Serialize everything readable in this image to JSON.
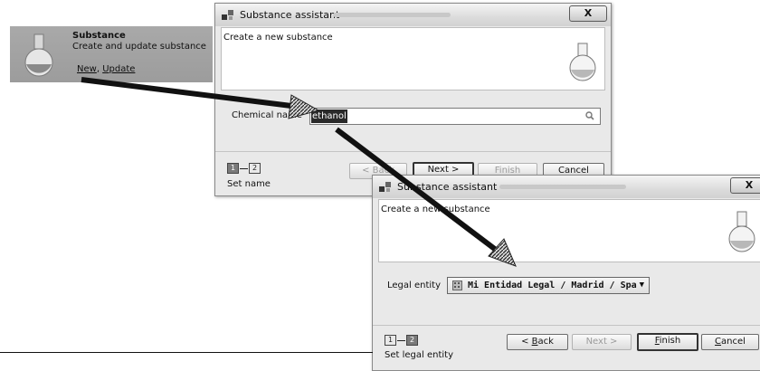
{
  "card": {
    "title": "Substance",
    "description": "Create and update substance",
    "link_new": "New",
    "link_separator": ",",
    "link_update": "Update",
    "icon": "flask-icon"
  },
  "dialog1": {
    "title": "Substance assistant",
    "close_label": "X",
    "header_text": "Create a new substance",
    "field_label": "Chemical name",
    "field_value": "ethanol",
    "step_1": "1",
    "step_2": "2",
    "step_label": "Set name",
    "back_label": "< Back",
    "next_label": "Next >",
    "finish_label": "Finish",
    "cancel_label": "Cancel"
  },
  "dialog2": {
    "title": "Substance assistant",
    "close_label": "X",
    "header_text": "Create a new substance",
    "field_label": "Legal entity",
    "select_value": "Mi Entidad Legal / Madrid / Spa",
    "step_1": "1",
    "step_2": "2",
    "step_label": "Set legal entity",
    "back_prefix": "< ",
    "back_key": "B",
    "back_rest": "ack",
    "next_label": "Next >",
    "finish_key": "F",
    "finish_rest": "inish",
    "cancel_key": "C",
    "cancel_rest": "ancel"
  },
  "colors": {
    "card_bg": "#a3a3a3",
    "dialog_bg": "#e9e9e9",
    "selection_bg": "#2a2a2a",
    "arrow": "#111111"
  }
}
